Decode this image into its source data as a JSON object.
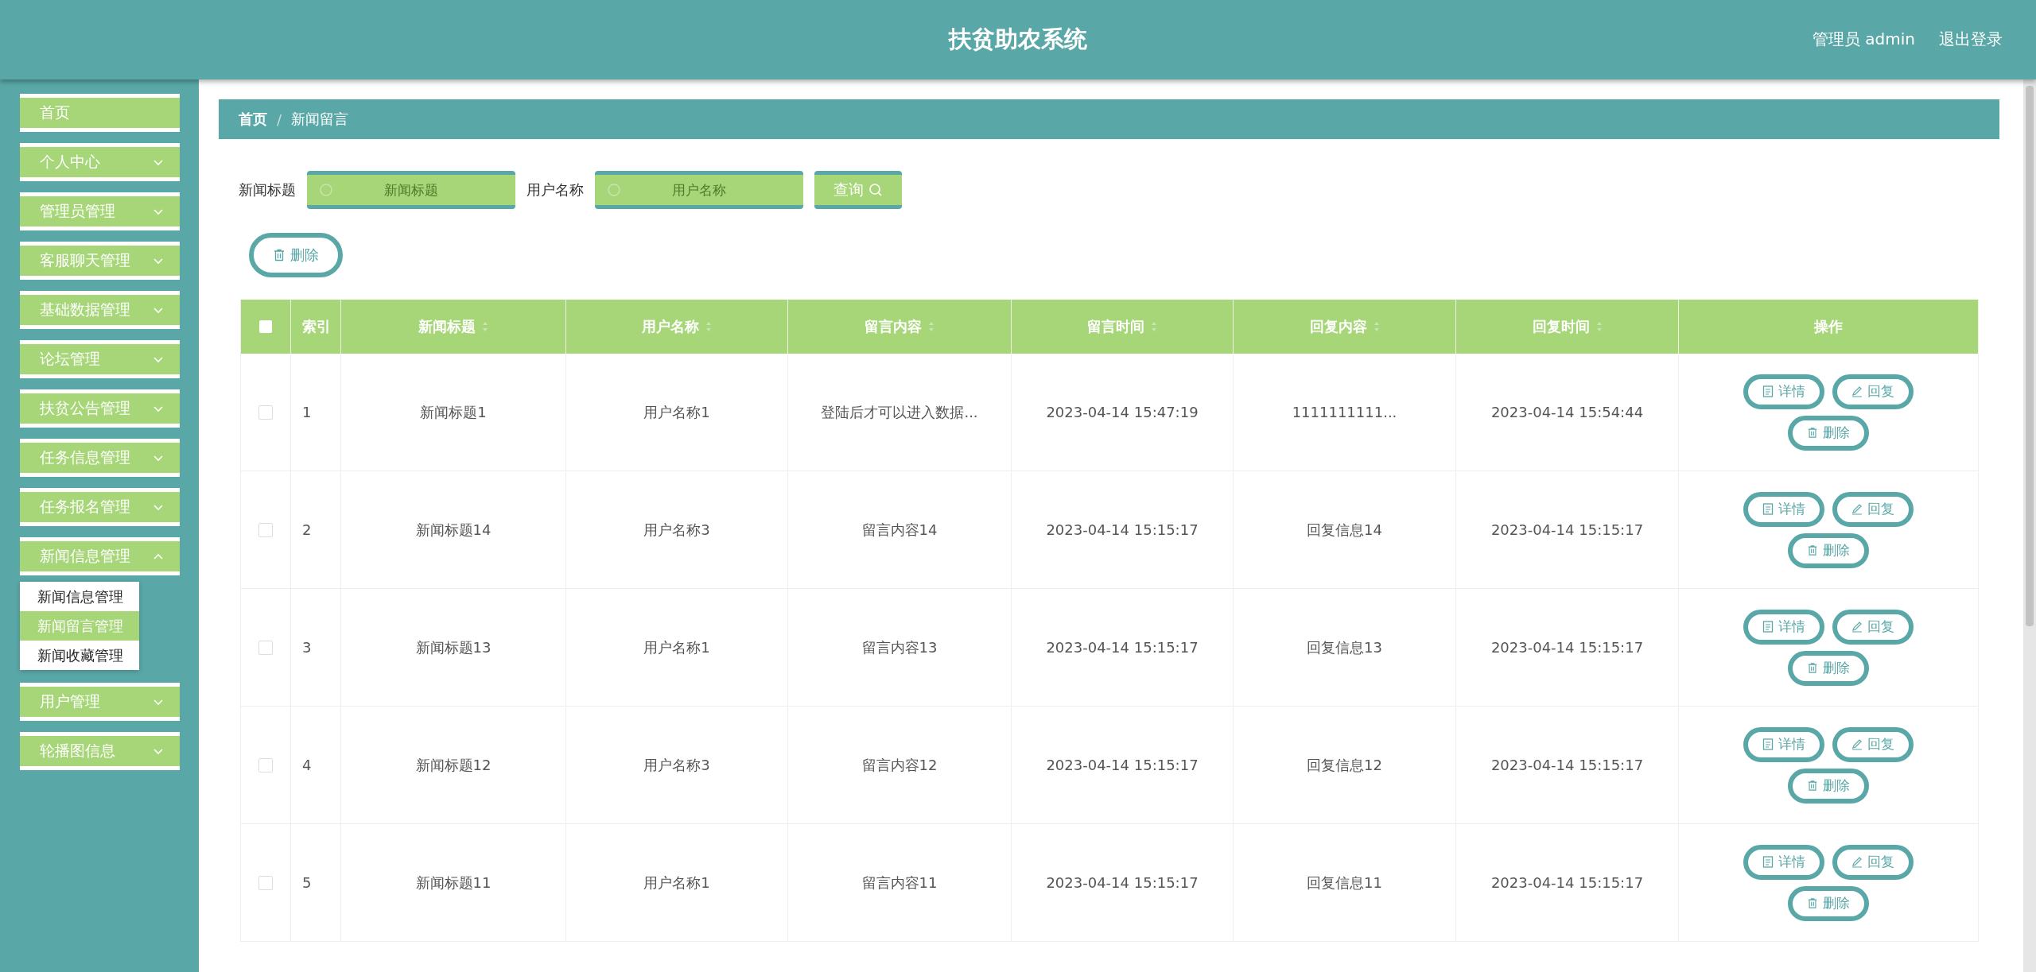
{
  "header": {
    "title": "扶贫助农系统",
    "user": "管理员 admin",
    "logout": "退出登录"
  },
  "sidebar": {
    "items": [
      {
        "label": "首页",
        "kind": "link"
      },
      {
        "label": "个人中心",
        "kind": "menu",
        "expanded": false
      },
      {
        "label": "管理员管理",
        "kind": "menu",
        "expanded": false
      },
      {
        "label": "客服聊天管理",
        "kind": "menu",
        "expanded": false
      },
      {
        "label": "基础数据管理",
        "kind": "menu",
        "expanded": false
      },
      {
        "label": "论坛管理",
        "kind": "menu",
        "expanded": false
      },
      {
        "label": "扶贫公告管理",
        "kind": "menu",
        "expanded": false
      },
      {
        "label": "任务信息管理",
        "kind": "menu",
        "expanded": false
      },
      {
        "label": "任务报名管理",
        "kind": "menu",
        "expanded": false
      },
      {
        "label": "新闻信息管理",
        "kind": "menu",
        "expanded": true,
        "children": [
          {
            "label": "新闻信息管理",
            "selected": false
          },
          {
            "label": "新闻留言管理",
            "selected": true
          },
          {
            "label": "新闻收藏管理",
            "selected": false
          }
        ]
      },
      {
        "label": "用户管理",
        "kind": "menu",
        "expanded": false
      },
      {
        "label": "轮播图信息",
        "kind": "menu",
        "expanded": false
      }
    ]
  },
  "breadcrumb": {
    "separator": "/",
    "items": [
      "首页",
      "新闻留言"
    ]
  },
  "search": {
    "fields": [
      {
        "label": "新闻标题",
        "placeholder": "新闻标题"
      },
      {
        "label": "用户名称",
        "placeholder": "用户名称"
      }
    ],
    "button": "查询"
  },
  "delete_button": "删除",
  "table": {
    "select_all_checked": false,
    "columns": [
      {
        "label": "索引",
        "sortable": false
      },
      {
        "label": "新闻标题",
        "sortable": true
      },
      {
        "label": "用户名称",
        "sortable": true
      },
      {
        "label": "留言内容",
        "sortable": true
      },
      {
        "label": "留言时间",
        "sortable": true
      },
      {
        "label": "回复内容",
        "sortable": true
      },
      {
        "label": "回复时间",
        "sortable": true
      },
      {
        "label": "操作",
        "sortable": false
      }
    ],
    "rows": [
      {
        "checked": false,
        "cells": [
          "1",
          "新闻标题1",
          "用户名称1",
          "登陆后才可以进入数据...",
          "2023-04-14 15:47:19",
          "1111111111...",
          "2023-04-14 15:54:44"
        ],
        "actions": [
          "详情",
          "回复",
          "删除"
        ]
      },
      {
        "checked": false,
        "cells": [
          "2",
          "新闻标题14",
          "用户名称3",
          "留言内容14",
          "2023-04-14 15:15:17",
          "回复信息14",
          "2023-04-14 15:15:17"
        ],
        "actions": [
          "详情",
          "回复",
          "删除"
        ]
      },
      {
        "checked": false,
        "cells": [
          "3",
          "新闻标题13",
          "用户名称1",
          "留言内容13",
          "2023-04-14 15:15:17",
          "回复信息13",
          "2023-04-14 15:15:17"
        ],
        "actions": [
          "详情",
          "回复",
          "删除"
        ]
      },
      {
        "checked": false,
        "cells": [
          "4",
          "新闻标题12",
          "用户名称3",
          "留言内容12",
          "2023-04-14 15:15:17",
          "回复信息12",
          "2023-04-14 15:15:17"
        ],
        "actions": [
          "详情",
          "回复",
          "删除"
        ]
      },
      {
        "checked": false,
        "cells": [
          "5",
          "新闻标题11",
          "用户名称1",
          "留言内容11",
          "2023-04-14 15:15:17",
          "回复信息11",
          "2023-04-14 15:15:17"
        ],
        "actions": [
          "详情",
          "回复",
          "删除"
        ]
      }
    ]
  }
}
